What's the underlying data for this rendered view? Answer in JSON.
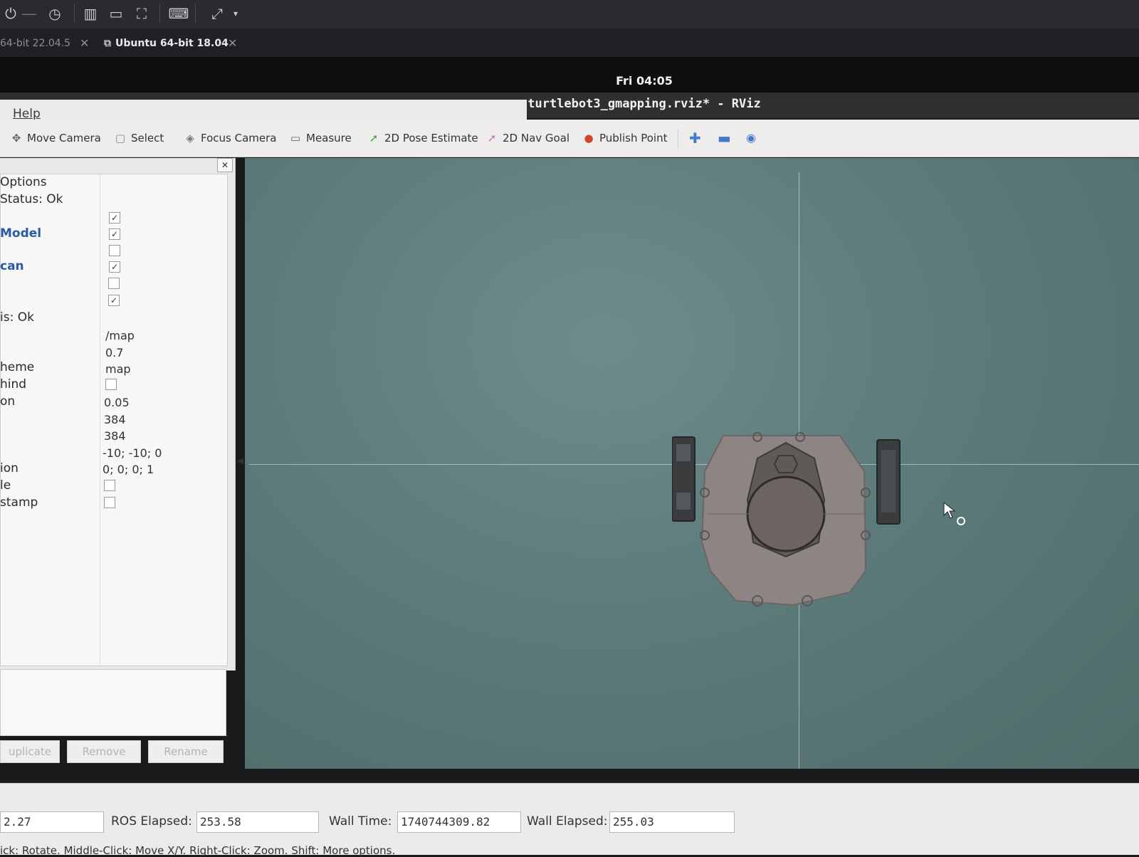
{
  "vm_host": {
    "tabs": [
      {
        "label": "64-bit 22.04.5"
      },
      {
        "label": "Ubuntu 64-bit 18.04"
      }
    ]
  },
  "ubuntu": {
    "clock": "Fri 04:05"
  },
  "window": {
    "title": "turtlebot3_gmapping.rviz* - RViz"
  },
  "menu": {
    "help_label": "Help"
  },
  "toolbar": {
    "tools": [
      {
        "label": "Move Camera",
        "icon": "move-camera-icon"
      },
      {
        "label": "Select",
        "icon": "select-icon"
      },
      {
        "label": "Focus Camera",
        "icon": "focus-camera-icon"
      },
      {
        "label": "Measure",
        "icon": "ruler-icon"
      },
      {
        "label": "2D Pose Estimate",
        "icon": "green-arrow-icon"
      },
      {
        "label": "2D Nav Goal",
        "icon": "pink-arrow-icon"
      },
      {
        "label": "Publish Point",
        "icon": "map-pin-icon"
      }
    ]
  },
  "displays": {
    "rows": [
      {
        "name": "Options"
      },
      {
        "name": "Status: Ok"
      },
      {
        "name": "Model"
      },
      {
        "name": "can"
      },
      {
        "name": "is: Ok"
      },
      {
        "name": "heme"
      },
      {
        "name": "hind"
      },
      {
        "name": "on"
      },
      {
        "name": "ion"
      },
      {
        "name": "le"
      },
      {
        "name": "stamp"
      }
    ],
    "values": [
      "/map",
      "0.7",
      "map",
      "0.05",
      "384",
      "384",
      "-10; -10; 0",
      "0; 0; 0; 1"
    ],
    "checkboxes": [
      true,
      true,
      false,
      true,
      false,
      true,
      false,
      false,
      false
    ],
    "buttons": {
      "duplicate": "uplicate",
      "remove": "Remove",
      "rename": "Rename"
    }
  },
  "time": {
    "ros_time_value": "2.27",
    "ros_elapsed_label": "ROS Elapsed:",
    "ros_elapsed_value": "253.58",
    "wall_time_label": "Wall Time:",
    "wall_time_value": "1740744309.82",
    "wall_elapsed_label": "Wall Elapsed:",
    "wall_elapsed_value": "255.03"
  },
  "hint": {
    "text": "ick: Rotate. Middle-Click: Move X/Y. Right-Click: Zoom. Shift: More options."
  },
  "colors": {
    "render_bg": "#5d7b7a",
    "link_blue": "#2a5aa8",
    "toolbar_bg": "#eeedeb"
  }
}
